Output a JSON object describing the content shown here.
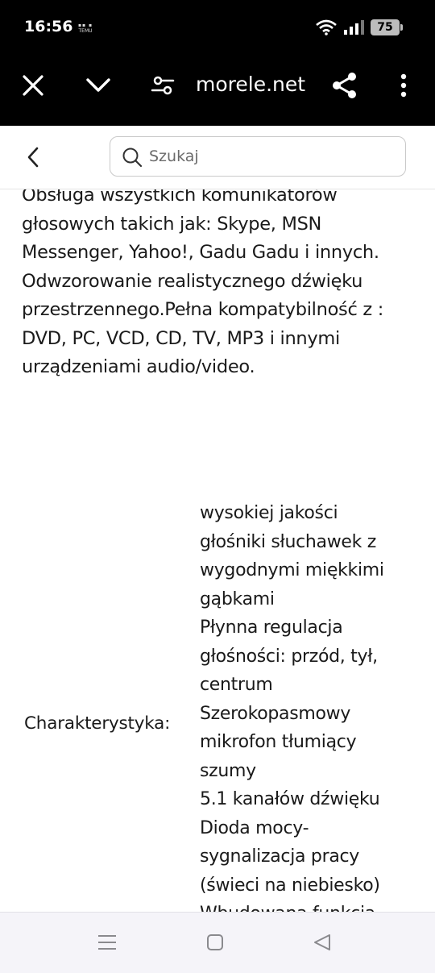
{
  "status_bar": {
    "time": "16:56",
    "temu_text": "TEMU",
    "battery": "75"
  },
  "browser": {
    "url": "morele.net"
  },
  "site_header": {
    "search_placeholder": "Szukaj"
  },
  "description_lines": [
    "Obsługa wszystkich komunikatorów",
    "głosowych takich jak: Skype, MSN",
    "Messenger, Yahoo!, Gadu Gadu i innych.",
    "Odwzorowanie realistycznego dźwięku",
    "przestrzennego.Pełna kompatybilność z :",
    "DVD, PC, VCD, CD, TV, MP3 i innymi",
    "urządzeniami audio/video."
  ],
  "spec": {
    "label": "Charakterystyka:",
    "value_lines": [
      "wysokiej jakości",
      "głośniki słuchawek z",
      "wygodnymi miękkimi",
      "gąbkami",
      "Płynna regulacja",
      "głośności: przód, tył,",
      "centrum",
      "Szerokopasmowy",
      "mikrofon tłumiący",
      "szumy",
      "5.1 kanałów dźwięku",
      "Dioda mocy-",
      "sygnalizacja pracy",
      "(świeci na niebiesko)",
      "Wbudowana funkcja"
    ]
  },
  "icons": {
    "close": "close-icon",
    "collapse": "chevron-down-icon",
    "site_settings": "tune-icon",
    "share": "share-icon",
    "more": "more-vert-icon",
    "back": "chevron-left-icon",
    "search": "search-icon",
    "nav_recents": "menu-icon",
    "nav_home": "square-icon",
    "nav_back": "triangle-back-icon"
  }
}
